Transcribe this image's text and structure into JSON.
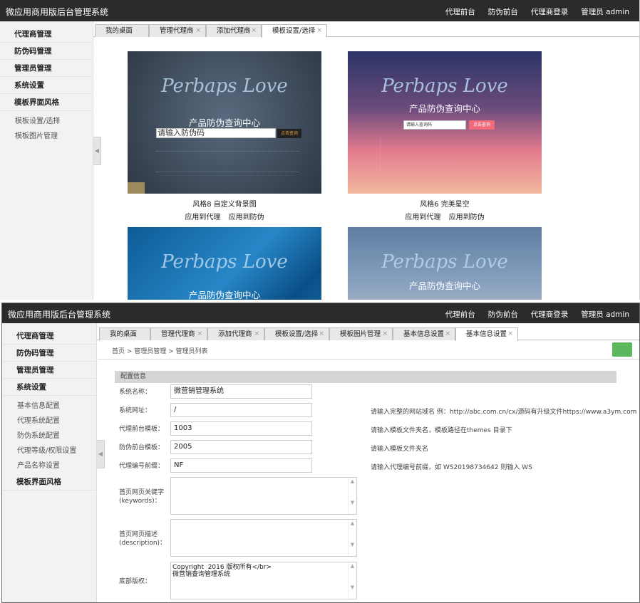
{
  "app_title": "微应用商用版后台管理系统",
  "top_nav": [
    "代理前台",
    "防伪前台",
    "代理商登录",
    "管理员  admin"
  ],
  "panel1": {
    "sidebar": {
      "items": [
        "代理商管理",
        "防伪码管理",
        "管理员管理",
        "系统设置",
        "模板界面风格"
      ],
      "subitems": [
        "模板设置/选择",
        "模板图片管理"
      ]
    },
    "tabs": [
      "我的桌面",
      "管理代理商",
      "添加代理商",
      "模板设置/选择"
    ],
    "tab_close": "×",
    "templates": [
      {
        "logo": "Perbaps Love",
        "subtitle": "产品防伪查询中心",
        "placeholder": "请输入防伪码",
        "button": "点击查询",
        "caption": "风格8 自定义背景图",
        "actions": [
          "应用到代理",
          "应用到防伪"
        ],
        "bg": "#3f4a5a"
      },
      {
        "logo": "Perbaps Love",
        "subtitle": "产品防伪查询中心",
        "placeholder": "请输入查询码",
        "button": "点击查询",
        "caption": "风格6 完美星空",
        "actions": [
          "应用到代理",
          "应用到防伪"
        ],
        "bg": "#d77a90"
      },
      {
        "logo": "Perbaps Love",
        "subtitle": "产品防伪查询中心",
        "bg": "#1d6fae"
      },
      {
        "logo": "Perbaps Love",
        "subtitle": "产品防伪查询中心",
        "bg": "#6c86a8"
      }
    ]
  },
  "panel2": {
    "sidebar": {
      "items_top": [
        "代理商管理",
        "防伪码管理",
        "管理员管理",
        "系统设置"
      ],
      "subitems": [
        "基本信息配置",
        "代理系统配置",
        "防伪系统配置",
        "代理等级/权限设置",
        "产品名称设置"
      ],
      "items_bottom": [
        "模板界面风格"
      ]
    },
    "tabs": [
      "我的桌面",
      "管理代理商",
      "添加代理商",
      "模板设置/选择",
      "模板图片管理",
      "基本信息设置",
      "基本信息设置"
    ],
    "breadcrumb": "首页  >  管理员管理  >  管理员列表",
    "section_title": "配置信息",
    "fields": [
      {
        "label": "系统名称：",
        "value": "微营销管理系统",
        "hint": ""
      },
      {
        "label": "系统网址：",
        "value": "/",
        "hint": "请输入完整的网站域名 例：http://abc.com.cn/cx/源码有升级文件https://www.a3ym.com"
      },
      {
        "label": "代理前台模板：",
        "value": "1003",
        "hint": "请输入模板文件夹名，模板路径在themes 目录下"
      },
      {
        "label": "防伪前台模板：",
        "value": "2005",
        "hint": "请输入模板文件夹名"
      },
      {
        "label": "代理编号前缀：",
        "value": "NF",
        "hint": "请输入代理编号前缀，如 WS20198734642 则输入 WS"
      }
    ],
    "textareas": [
      {
        "label": "首页网页关键字\n(keywords)：",
        "value": ""
      },
      {
        "label": "首页网页描述\n(description)：",
        "value": ""
      },
      {
        "label": "底部版权：",
        "value": "Copyright  2016 版权所有</br>\n微营销查询管理系统"
      }
    ]
  }
}
